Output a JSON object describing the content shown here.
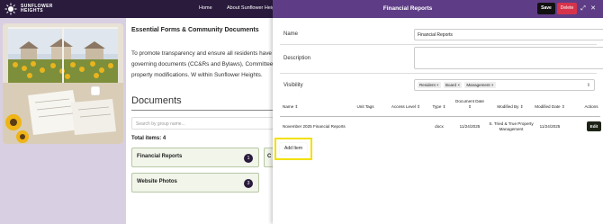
{
  "nav": {
    "logo_line1": "SUNFLOWER",
    "logo_line2": "HEIGHTS",
    "links": [
      "Home",
      "About Sunflower Heigh"
    ]
  },
  "content": {
    "section_title": "Essential Forms & Community Documents",
    "intro_text": "To promote transparency and ensure all residents have eas find the official governing documents (CC&Rs and Bylaws), Committee (ARC) application for property modifications. W within Sunflower Heights.",
    "documents_heading": "Documents",
    "search_placeholder": "Search by group name...",
    "total_items": "Total items: 4",
    "cards": [
      {
        "label": "Financial Reports",
        "count": "1"
      },
      {
        "label": "Website Photos",
        "count": "3"
      }
    ],
    "partial_card_letter": "C"
  },
  "modal": {
    "title": "Financial Reports",
    "save_label": "Save",
    "delete_label": "Delete",
    "expand_icon": "expand-icon",
    "close_icon": "close-icon",
    "fields": {
      "name_label": "Name",
      "name_value": "Financial Reports",
      "description_label": "Description",
      "description_value": "",
      "visibility_label": "Visibility",
      "visibility_chips": [
        "Resident",
        "Board",
        "Management"
      ]
    },
    "table": {
      "headers": [
        "Name",
        "Unit Tags",
        "Access Level",
        "Type",
        "Document Date",
        "Modified By",
        "Modified Date",
        "Actions"
      ],
      "rows": [
        {
          "name": "November 2025 Financial Reports",
          "unit_tags": "",
          "access_level": "",
          "type": "docx",
          "document_date": "11/24/2025",
          "modified_by": "S. Tried & True Property Management",
          "modified_date": "11/24/2025",
          "action": "Edit"
        }
      ]
    },
    "add_item_label": "Add Item"
  },
  "colors": {
    "nav_bg": "#2a1b3d",
    "modal_header": "#5e3d86",
    "delete": "#d6334a",
    "highlight": "#f2e000",
    "card_bg": "#f1f5ea"
  }
}
